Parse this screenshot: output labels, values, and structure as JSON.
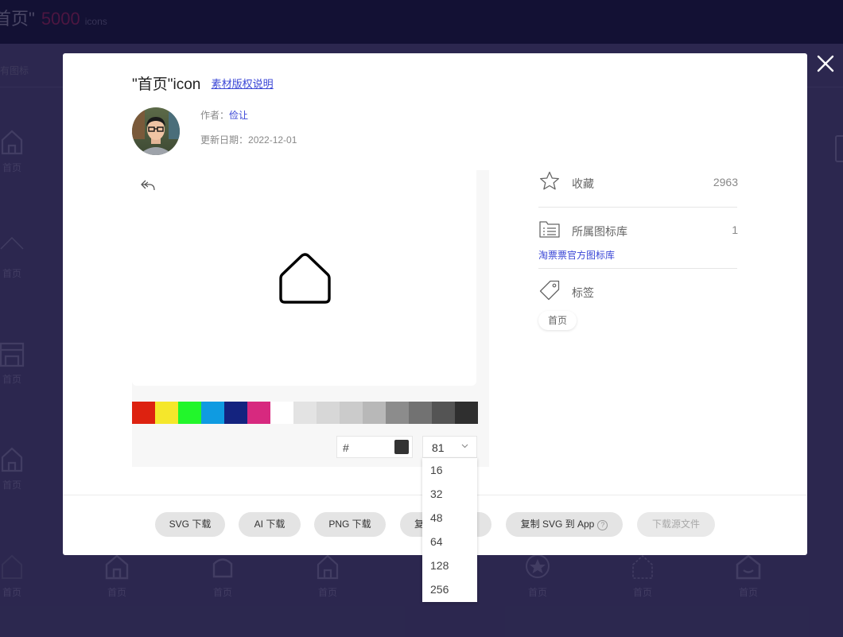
{
  "background": {
    "title_text": "首页\"",
    "count": "5000",
    "unit": "icons",
    "filter_label": "有图标",
    "icon_label": "首页"
  },
  "modal": {
    "title": "\"首页\"icon",
    "copyright_link": "素材版权说明",
    "author_label": "作者：",
    "author_name": "俭让",
    "date_label": "更新日期：",
    "date_value": "2022-12-01",
    "hex_prefix": "#",
    "hex_value": "",
    "selected_size": "81",
    "icon_color": "#000000",
    "current_color": "#333333",
    "swatch_colors": [
      "#dd2210",
      "#f5e72b",
      "#22f62b",
      "#0f9be1",
      "#14237f",
      "#d7297f",
      "#ffffff",
      "#e3e3e3",
      "#d7d7d7",
      "#cbcbcb",
      "#b8b8b8",
      "#8c8c8c",
      "#727272",
      "#545454",
      "#2f2f2f"
    ]
  },
  "sidebar": {
    "favorites_label": "收藏",
    "favorites_count": "2963",
    "library_label": "所属图标库",
    "library_count": "1",
    "library_link": "淘票票官方图标库",
    "tags_label": "标签",
    "tag": "首页"
  },
  "buttons": {
    "svg": "SVG 下载",
    "ai": "AI 下载",
    "png": "PNG 下载",
    "copy_svg_partial": "复",
    "copy_to_app": "复制 SVG 到 App",
    "help_glyph": "?",
    "source": "下载源文件"
  },
  "size_options": [
    "16",
    "32",
    "48",
    "64",
    "128",
    "256"
  ],
  "icons": {
    "close": "close-icon",
    "undo": "undo-icon",
    "star": "star-icon",
    "library": "folder-list-icon",
    "tag": "tag-icon",
    "caret": "chevron-down-icon",
    "home": "home-icon"
  }
}
